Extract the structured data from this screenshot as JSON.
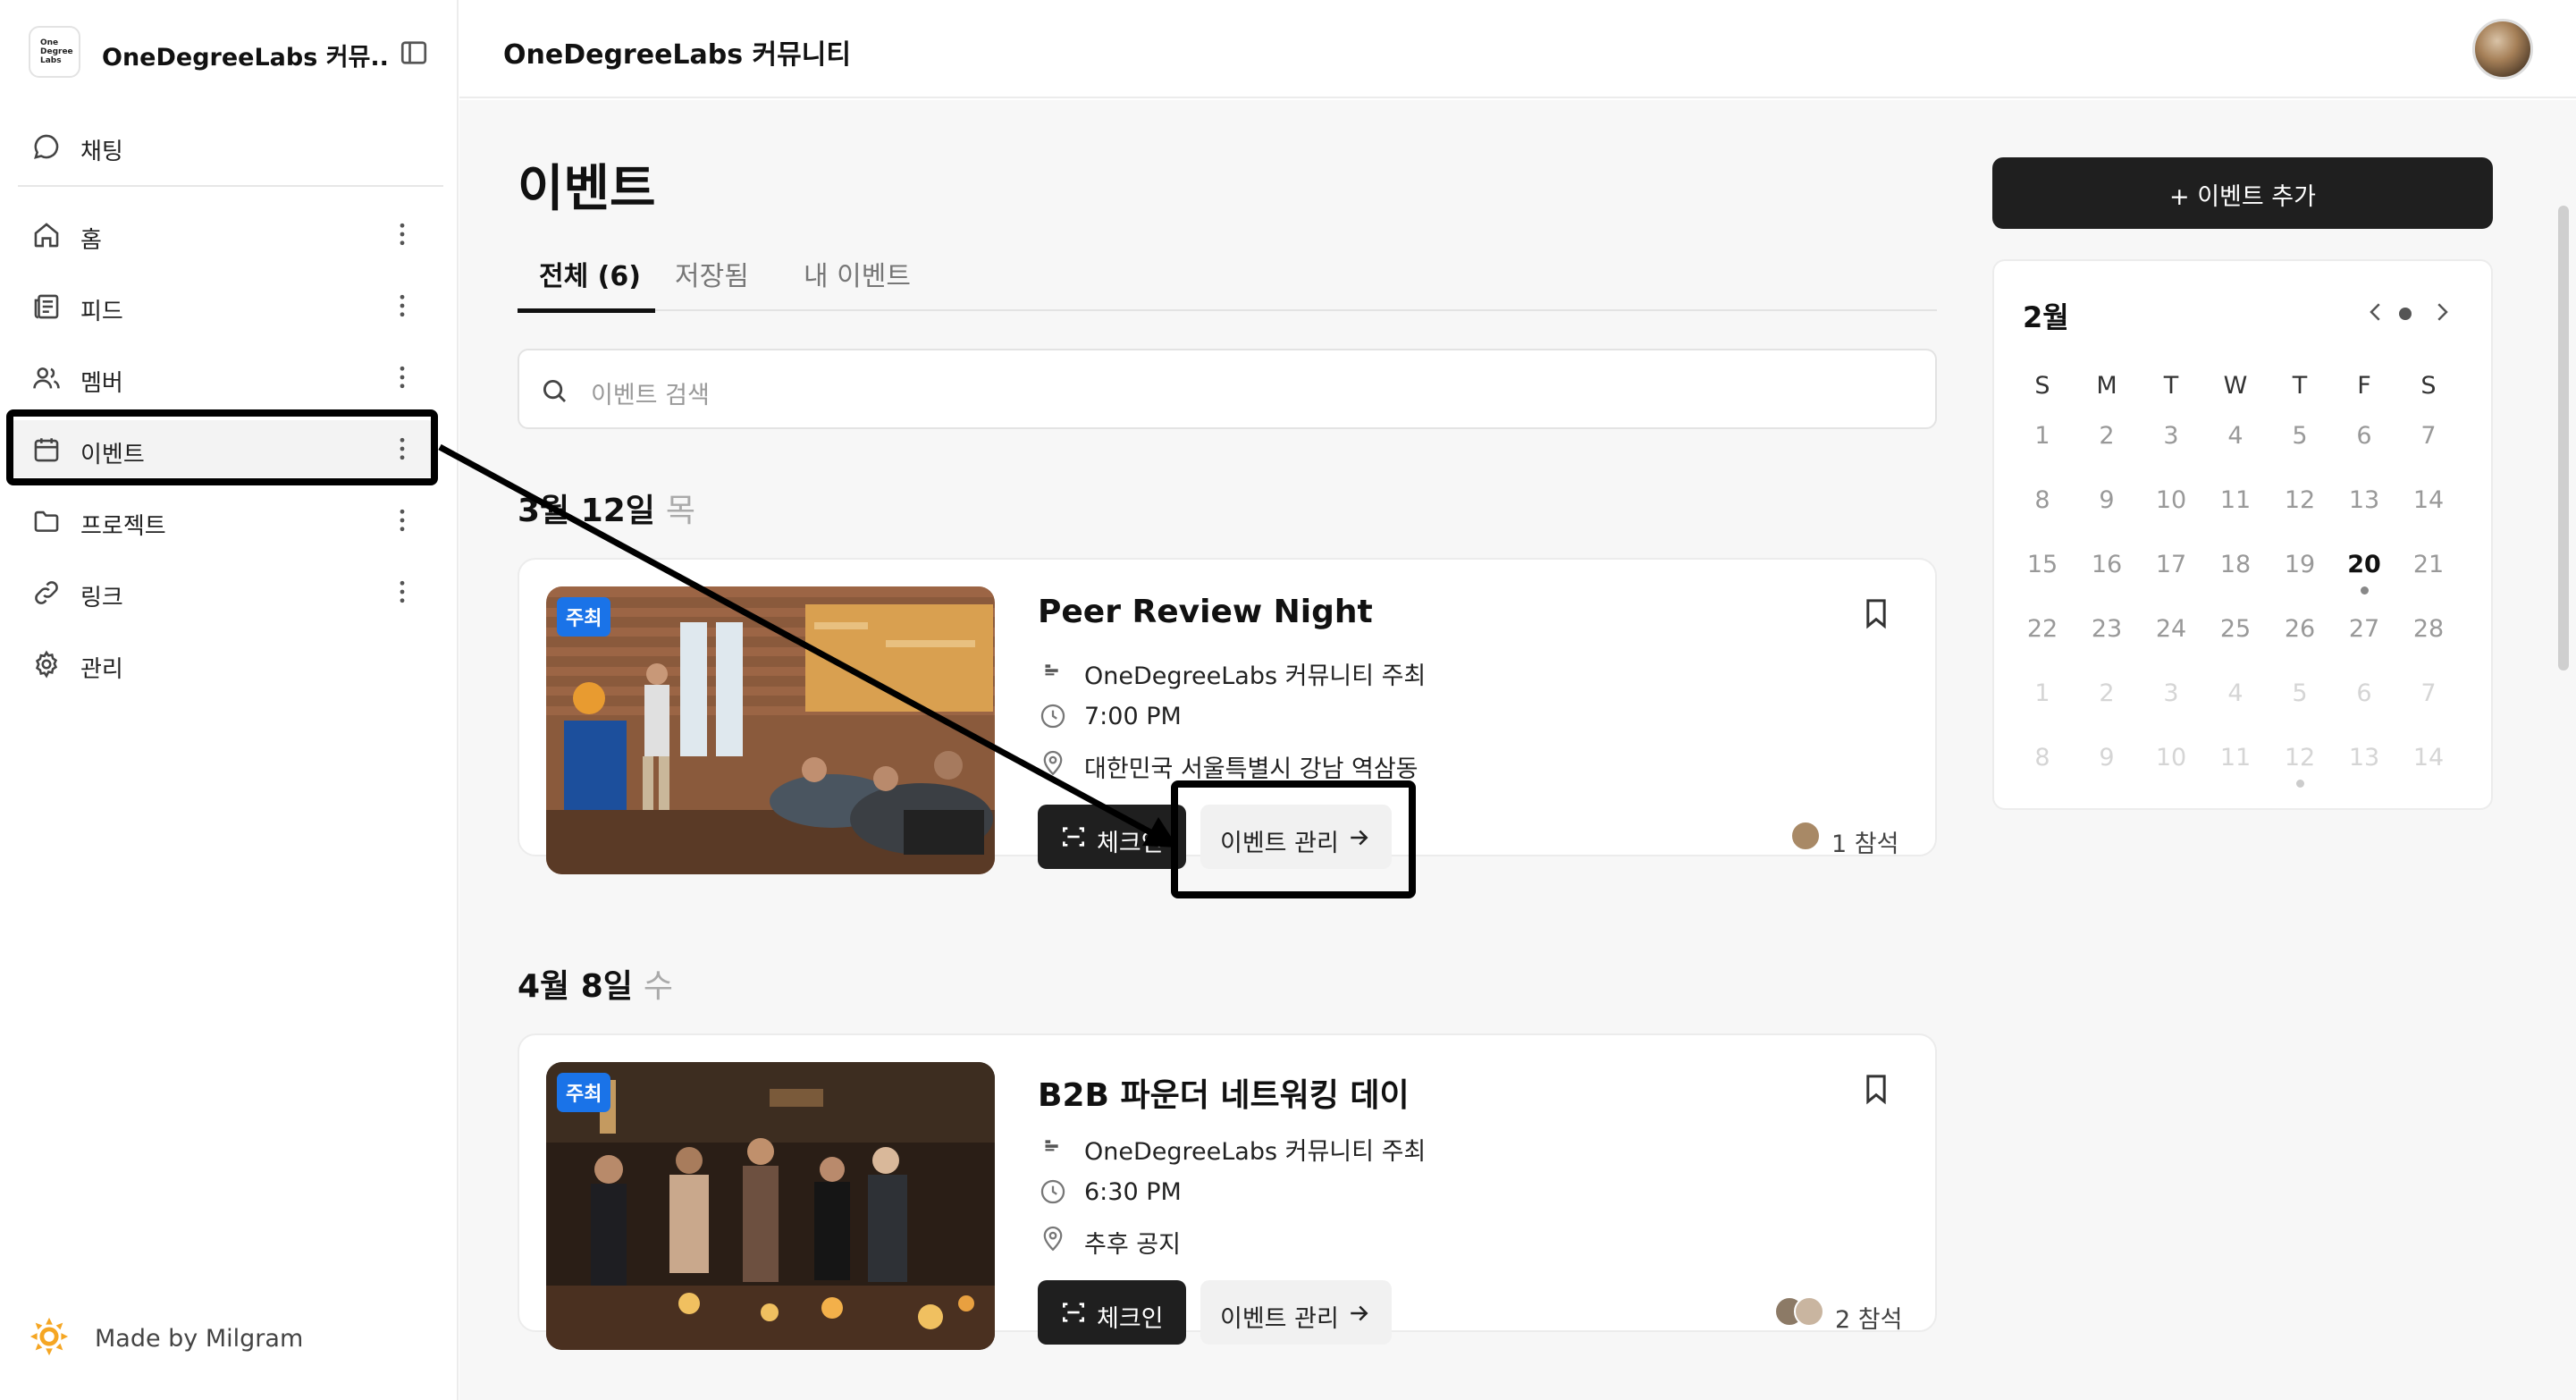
{
  "sidebar": {
    "logo_text": "One Degree Labs",
    "community_name": "OneDegreeLabs 커뮤...",
    "chat_label": "채팅",
    "items": [
      {
        "label": "홈",
        "icon": "home-icon"
      },
      {
        "label": "피드",
        "icon": "feed-icon"
      },
      {
        "label": "멤버",
        "icon": "members-icon"
      },
      {
        "label": "이벤트",
        "icon": "calendar-icon"
      },
      {
        "label": "프로젝트",
        "icon": "folder-icon"
      },
      {
        "label": "링크",
        "icon": "link-icon"
      },
      {
        "label": "관리",
        "icon": "gear-icon"
      }
    ],
    "made_by": "Made by Milgram"
  },
  "topbar": {
    "title": "OneDegreeLabs 커뮤니티"
  },
  "main": {
    "page_title": "이벤트",
    "tabs": [
      {
        "label": "전체 (6)",
        "active": true
      },
      {
        "label": "저장됨",
        "active": false
      },
      {
        "label": "내 이벤트",
        "active": false
      }
    ],
    "search_placeholder": "이벤트 검색",
    "groups": [
      {
        "date": "3월 12일",
        "weekday": "목",
        "event": {
          "badge": "주최",
          "title": "Peer Review Night",
          "host": "OneDegreeLabs 커뮤니티 주최",
          "time": "7:00 PM",
          "location": "대한민국 서울특별시 강남 역삼동",
          "checkin_label": "체크인",
          "manage_label": "이벤트 관리",
          "attendees": "1 참석"
        }
      },
      {
        "date": "4월 8일",
        "weekday": "수",
        "event": {
          "badge": "주최",
          "title": "B2B 파운더 네트워킹 데이",
          "host": "OneDegreeLabs 커뮤니티 주최",
          "time": "6:30 PM",
          "location": "추후 공지",
          "checkin_label": "체크인",
          "manage_label": "이벤트 관리",
          "attendees": "2 참석"
        }
      }
    ]
  },
  "right": {
    "add_event_label": "+ 이벤트 추가",
    "calendar": {
      "month": "2월",
      "weekdays": [
        "S",
        "M",
        "T",
        "W",
        "T",
        "F",
        "S"
      ],
      "days": [
        "1",
        "2",
        "3",
        "4",
        "5",
        "6",
        "7",
        "8",
        "9",
        "10",
        "11",
        "12",
        "13",
        "14",
        "15",
        "16",
        "17",
        "18",
        "19",
        "20",
        "21",
        "22",
        "23",
        "24",
        "25",
        "26",
        "27",
        "28",
        "1",
        "2",
        "3",
        "4",
        "5",
        "6",
        "7",
        "8",
        "9",
        "10",
        "11",
        "12",
        "13",
        "14"
      ],
      "today": "20",
      "event_days": [
        "20",
        "12 (next month)"
      ]
    }
  },
  "colors": {
    "accent_dark": "#1f1f1f",
    "badge_blue": "#1a73e8",
    "page_bg": "#f7f7f7"
  }
}
